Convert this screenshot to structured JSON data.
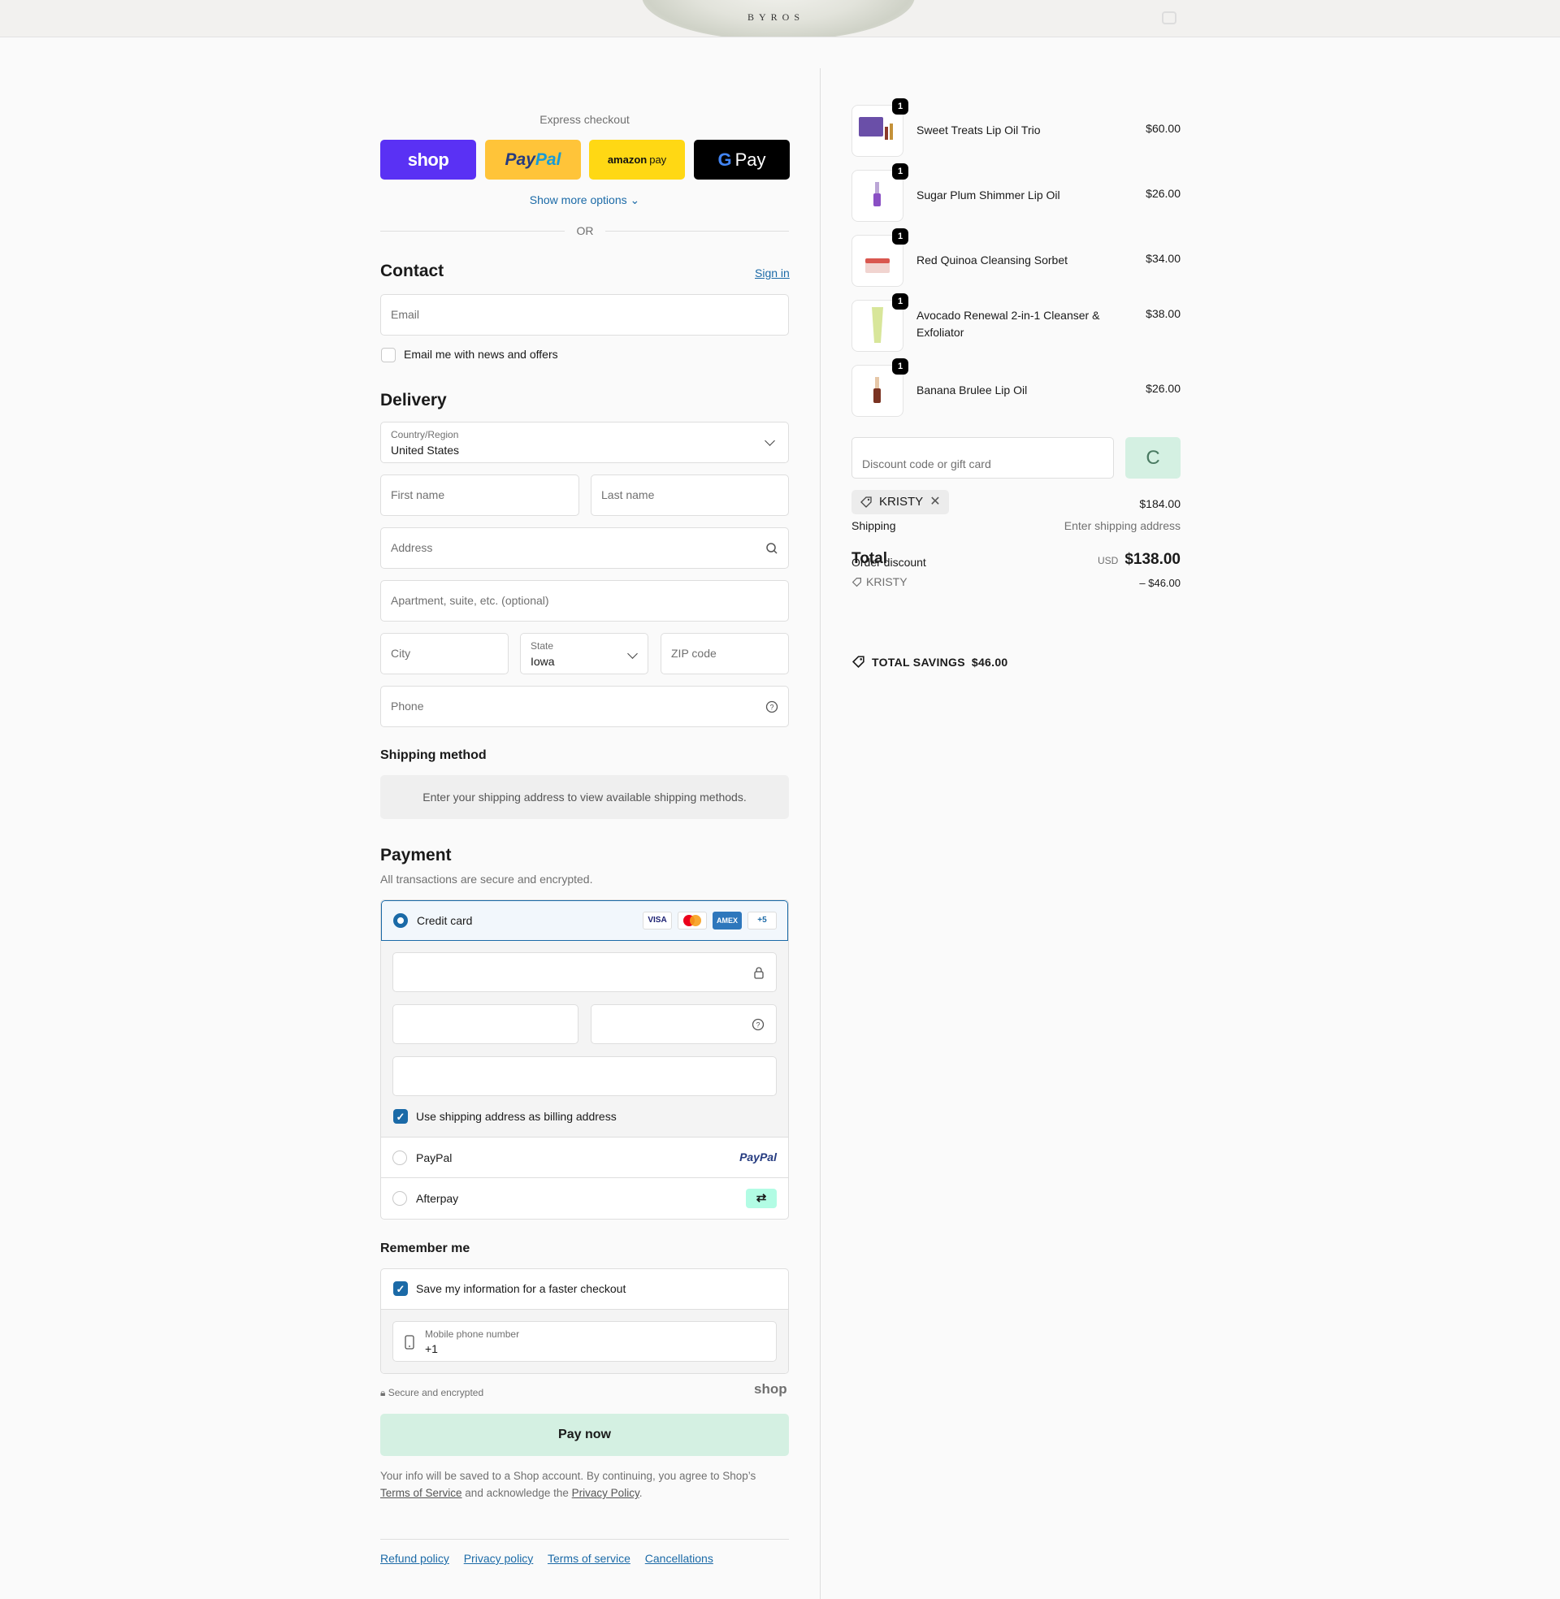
{
  "header": {
    "brand": "BYROS",
    "cart_icon": "bag-icon"
  },
  "express": {
    "title": "Express checkout",
    "shop_label": "shop",
    "paypal_label_a": "Pay",
    "paypal_label_b": "Pal",
    "amazon_label_a": "amazon",
    "amazon_label_b": "pay",
    "gpay_label_g": "G",
    "gpay_label": "Pay",
    "show_more": "Show more options",
    "or": "OR"
  },
  "contact": {
    "title": "Contact",
    "sign_in": "Sign in",
    "email_placeholder": "Email",
    "news_label": "Email me with news and offers"
  },
  "delivery": {
    "title": "Delivery",
    "country_label": "Country/Region",
    "country_value": "United States",
    "first_name": "First name",
    "last_name": "Last name",
    "address": "Address",
    "apartment": "Apartment, suite, etc. (optional)",
    "city": "City",
    "state_label": "State",
    "state_value": "Iowa",
    "zip": "ZIP code",
    "phone": "Phone"
  },
  "shipping_method": {
    "title": "Shipping method",
    "message": "Enter your shipping address to view available shipping methods."
  },
  "payment": {
    "title": "Payment",
    "subtitle": "All transactions are secure and encrypted.",
    "credit_card": "Credit card",
    "card_logos": [
      "VISA",
      "",
      "AMEX",
      "+5"
    ],
    "billing_label": "Use shipping address as billing address",
    "paypal": "PayPal",
    "paypal_logo": "PayPal",
    "afterpay": "Afterpay"
  },
  "remember": {
    "title": "Remember me",
    "save_label": "Save my information for a faster checkout",
    "phone_label": "Mobile phone number",
    "phone_value": "+1",
    "secure": "Secure and encrypted",
    "shop_logo": "shop"
  },
  "pay_now": "Pay now",
  "legal": {
    "text_a": "Your info will be saved to a Shop account. By continuing, you agree to Shop’s",
    "terms": "Terms of Service",
    "text_b": "and acknowledge the",
    "privacy": "Privacy Policy",
    "text_c": "."
  },
  "footer": [
    "Refund policy",
    "Privacy policy",
    "Terms of service",
    "Cancellations"
  ],
  "cart": {
    "items": [
      {
        "qty": "1",
        "name": "Sweet Treats Lip Oil Trio",
        "price": "$60.00"
      },
      {
        "qty": "1",
        "name": "Sugar Plum Shimmer Lip Oil",
        "price": "$26.00"
      },
      {
        "qty": "1",
        "name": "Red Quinoa Cleansing Sorbet",
        "price": "$34.00"
      },
      {
        "qty": "1",
        "name": "Avocado Renewal 2-in-1 Cleanser & Exfoliator",
        "price": "$38.00"
      },
      {
        "qty": "1",
        "name": "Banana Brulee Lip Oil",
        "price": "$26.00"
      }
    ],
    "discount_placeholder": "Discount code or gift card",
    "apply_glyph": "C",
    "code": "KRISTY",
    "subtotal": "$184.00",
    "shipping_label": "Shipping",
    "shipping_value": "Enter shipping address",
    "order_discount_label": "Order discount",
    "total_label": "Total",
    "currency": "USD",
    "total": "$138.00",
    "discount_code": "KRISTY",
    "discount_amount": "– $46.00",
    "savings_label": "TOTAL SAVINGS",
    "savings_value": "$46.00"
  }
}
